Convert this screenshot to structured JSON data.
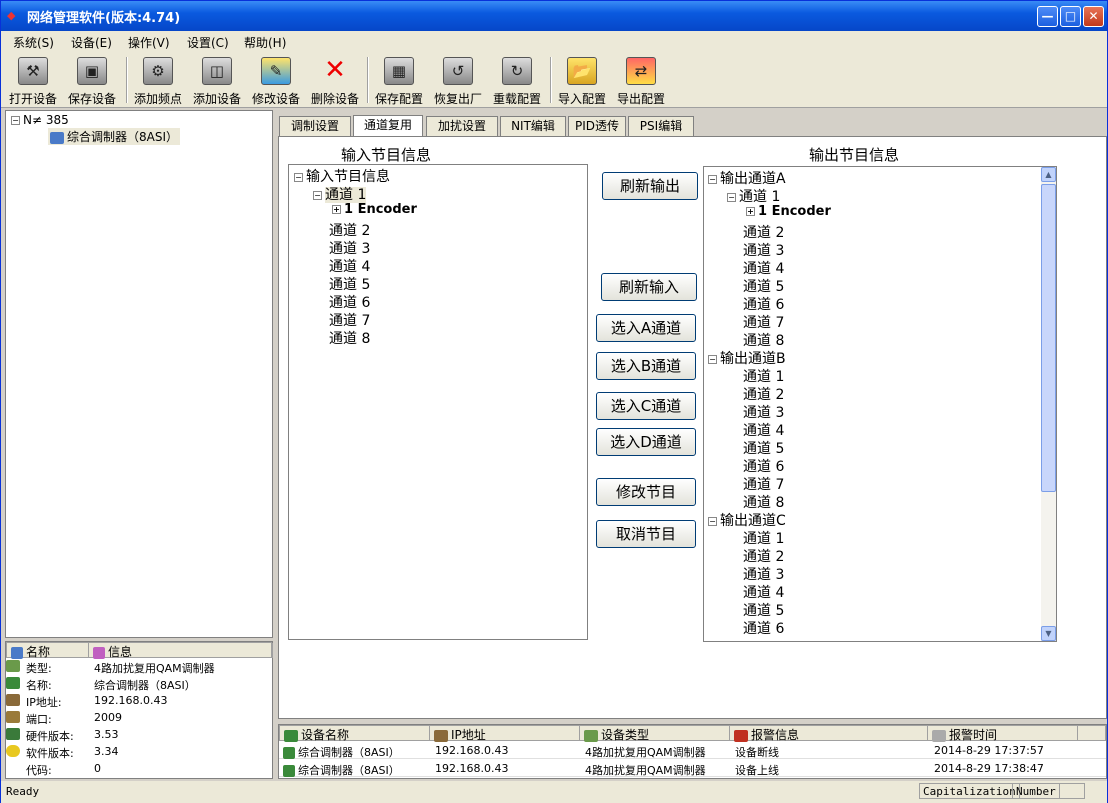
{
  "window": {
    "title": "网络管理软件(版本:4.74)",
    "min": "—",
    "max": "□",
    "close": "✕"
  },
  "menu": [
    {
      "label": "系统(S)"
    },
    {
      "label": "设备(E)"
    },
    {
      "label": "操作(V)"
    },
    {
      "label": "设置(C)"
    },
    {
      "label": "帮助(H)"
    }
  ],
  "toolbar": [
    {
      "label": "打开设备",
      "icon": "open-device-icon"
    },
    {
      "label": "保存设备",
      "icon": "save-device-icon"
    },
    {
      "label": "添加频点",
      "icon": "add-frequency-icon"
    },
    {
      "label": "添加设备",
      "icon": "add-device-icon"
    },
    {
      "label": "修改设备",
      "icon": "edit-device-icon"
    },
    {
      "label": "删除设备",
      "icon": "delete-device-icon"
    },
    {
      "label": "保存配置",
      "icon": "save-config-icon"
    },
    {
      "label": "恢复出厂",
      "icon": "factory-reset-icon"
    },
    {
      "label": "重载配置",
      "icon": "reload-config-icon"
    },
    {
      "label": "导入配置",
      "icon": "import-config-icon"
    },
    {
      "label": "导出配置",
      "icon": "export-config-icon"
    }
  ],
  "device_tree": {
    "root": "N≠ 385",
    "child": "综合调制器（8ASI）"
  },
  "tabs": [
    {
      "label": "调制设置"
    },
    {
      "label": "通道复用"
    },
    {
      "label": "加扰设置"
    },
    {
      "label": "NIT编辑"
    },
    {
      "label": "PID透传"
    },
    {
      "label": "PSI编辑"
    }
  ],
  "input": {
    "title": "输入节目信息",
    "root": "输入节目信息",
    "channel1": "通道 1",
    "encoder": "1 Encoder",
    "channels": [
      "通道 2",
      "通道 3",
      "通道 4",
      "通道 5",
      "通道 6",
      "通道 7",
      "通道 8"
    ]
  },
  "output": {
    "title": "输出节目信息",
    "groupA": "输出通道A",
    "a_ch1": "通道 1",
    "encoder": "1 Encoder",
    "a_channels": [
      "通道 2",
      "通道 3",
      "通道 4",
      "通道 5",
      "通道 6",
      "通道 7",
      "通道 8"
    ],
    "groupB": "输出通道B",
    "b_channels": [
      "通道 1",
      "通道 2",
      "通道 3",
      "通道 4",
      "通道 5",
      "通道 6",
      "通道 7",
      "通道 8"
    ],
    "groupC": "输出通道C",
    "c_channels": [
      "通道 1",
      "通道 2",
      "通道 3",
      "通道 4",
      "通道 5",
      "通道 6"
    ]
  },
  "buttons": {
    "refresh_output": "刷新输出",
    "refresh_input": "刷新输入",
    "select_a": "选入A通道",
    "select_b": "选入B通道",
    "select_c": "选入C通道",
    "select_d": "选入D通道",
    "edit_program": "修改节目",
    "cancel_program": "取消节目"
  },
  "props": {
    "head_name": "名称",
    "head_info": "信息",
    "rows": [
      {
        "key": "类型:",
        "value": "4路加扰复用QAM调制器"
      },
      {
        "key": "名称:",
        "value": "综合调制器（8ASI）"
      },
      {
        "key": "IP地址:",
        "value": "192.168.0.43"
      },
      {
        "key": "端口:",
        "value": "2009"
      },
      {
        "key": "硬件版本:",
        "value": "3.53"
      },
      {
        "key": "软件版本:",
        "value": "3.34"
      },
      {
        "key": "代码:",
        "value": "0"
      }
    ]
  },
  "alarms": {
    "headers": [
      "设备名称",
      "IP地址",
      "设备类型",
      "报警信息",
      "报警时间"
    ],
    "rows": [
      {
        "name": "综合调制器（8ASI）",
        "ip": "192.168.0.43",
        "type": "4路加扰复用QAM调制器",
        "msg": "设备断线",
        "time": "2014-8-29 17:37:57"
      },
      {
        "name": "综合调制器（8ASI）",
        "ip": "192.168.0.43",
        "type": "4路加扰复用QAM调制器",
        "msg": "设备上线",
        "time": "2014-8-29 17:38:47"
      }
    ]
  },
  "status": {
    "ready": "Ready",
    "cap": "Capitalization",
    "num": "Number"
  }
}
